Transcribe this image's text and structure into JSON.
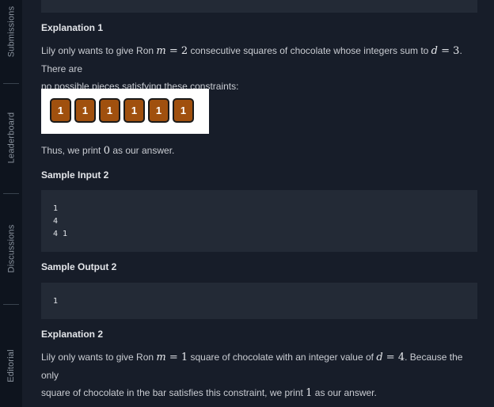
{
  "sidebar": {
    "tabs": [
      {
        "label": "Submissions"
      },
      {
        "label": "Leaderboard"
      },
      {
        "label": "Discussions"
      },
      {
        "label": "Editorial"
      }
    ]
  },
  "content": {
    "explanation1": {
      "heading": "Explanation 1",
      "para_part1": "Lily only wants to give Ron ",
      "m_var": "m",
      "m_eq": " = 2",
      "para_part2": " consecutive squares of chocolate whose integers sum to ",
      "d_var": "d",
      "d_eq": " = 3",
      "para_part3": ". There are",
      "para_line2": "no possible pieces satisfying these constraints:"
    },
    "figure": {
      "squares": [
        "1",
        "1",
        "1",
        "1",
        "1",
        "1"
      ]
    },
    "conclusion1": {
      "part1": "Thus, we print ",
      "value": "0",
      "part2": " as our answer."
    },
    "sample_input2": {
      "heading": "Sample Input 2",
      "lines": [
        "1",
        "4",
        "4 1"
      ]
    },
    "sample_output2": {
      "heading": "Sample Output 2",
      "lines": [
        "1"
      ]
    },
    "explanation2": {
      "heading": "Explanation 2",
      "part1": "Lily only wants to give Ron ",
      "m_var": "m",
      "m_eq": " = 1",
      "part2": " square of chocolate with an integer value of ",
      "d_var": "d",
      "d_eq": " = 4",
      "part3": ". Because the only",
      "line2_part1": "square of chocolate in the bar satisfies this constraint, we print ",
      "line2_value": "1",
      "line2_part2": " as our answer."
    }
  }
}
